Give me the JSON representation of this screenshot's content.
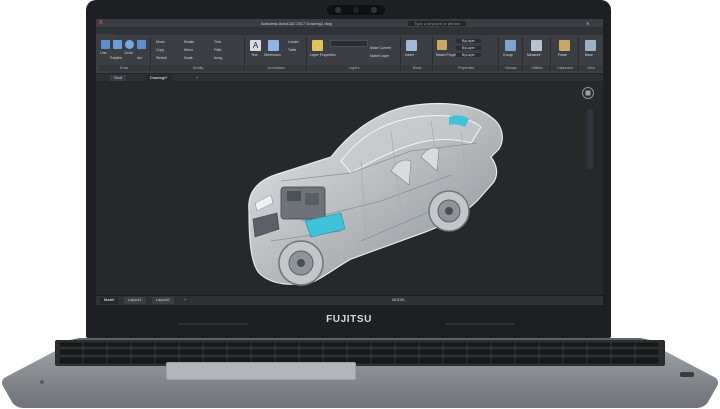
{
  "brand": "FUJITSU",
  "app": {
    "title": "Autodesk AutoCAD 2017   Drawing1.dwg",
    "search_placeholder": "Type a keyword or phrase"
  },
  "ribbon": {
    "tabs": [
      "Home",
      "Insert",
      "Annotate",
      "Parametric",
      "View",
      "Manage",
      "Output",
      "Add-ins",
      "A360",
      "Express Tools",
      "Featured Apps",
      "BIM 360",
      "Performance"
    ],
    "groups": [
      {
        "label": "Draw",
        "items": [
          "Line",
          "Polyline",
          "Circle",
          "Arc"
        ]
      },
      {
        "label": "Modify",
        "items": [
          "Move",
          "Rotate",
          "Copy",
          "Mirror",
          "Stretch",
          "Scale",
          "Trim",
          "Fillet",
          "Array"
        ]
      },
      {
        "label": "Annotation",
        "items": [
          "Text",
          "Dimension",
          "Leader",
          "Table"
        ]
      },
      {
        "label": "Layers",
        "items": [
          "Layer Properties",
          "Make Current",
          "Match Layer"
        ]
      },
      {
        "label": "Block",
        "items": [
          "Insert",
          "Create",
          "Edit"
        ]
      },
      {
        "label": "Properties",
        "items": [
          "Match Properties",
          "ByLayer",
          "ByLayer",
          "ByLayer"
        ]
      },
      {
        "label": "Groups",
        "items": [
          "Group"
        ]
      },
      {
        "label": "Utilities",
        "items": [
          "Measure"
        ]
      },
      {
        "label": "Clipboard",
        "items": [
          "Paste"
        ]
      },
      {
        "label": "View",
        "items": [
          "Base"
        ]
      }
    ]
  },
  "doc_tabs": [
    "Start",
    "Drawing1*"
  ],
  "layout_tabs": [
    "Model",
    "Layout1",
    "Layout2"
  ],
  "status": {
    "mode": "MODEL"
  },
  "colors": {
    "accent": "#3ec3d8",
    "bezel": "#1d1f22",
    "canvas": "#26282a",
    "chassis": "#8e9195"
  }
}
